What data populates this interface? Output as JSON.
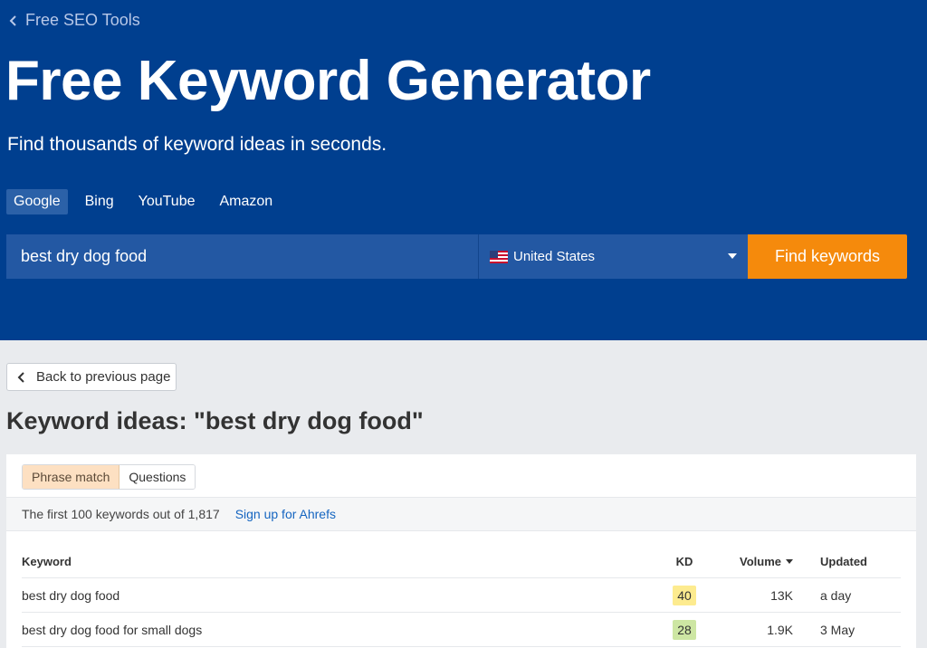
{
  "breadcrumb": {
    "label": "Free SEO Tools"
  },
  "hero": {
    "title": "Free Keyword Generator",
    "subtitle": "Find thousands of keyword ideas in seconds."
  },
  "engines": [
    {
      "label": "Google",
      "active": true
    },
    {
      "label": "Bing",
      "active": false
    },
    {
      "label": "YouTube",
      "active": false
    },
    {
      "label": "Amazon",
      "active": false
    }
  ],
  "search": {
    "query": "best dry dog food",
    "country": "United States",
    "submit_label": "Find keywords"
  },
  "back_label": "Back to previous page",
  "results": {
    "heading": "Keyword ideas: \"best dry dog food\"",
    "tabs": [
      {
        "label": "Phrase match",
        "active": true
      },
      {
        "label": "Questions",
        "active": false
      }
    ],
    "count_text": "The first 100 keywords out of 1,817",
    "signup_label": "Sign up for Ahrefs",
    "columns": {
      "keyword": "Keyword",
      "kd": "KD",
      "volume": "Volume",
      "updated": "Updated"
    },
    "rows": [
      {
        "keyword": "best dry dog food",
        "kd": "40",
        "kd_color": "#fdeb8f",
        "volume": "13K",
        "updated": "a day"
      },
      {
        "keyword": "best dry dog food for small dogs",
        "kd": "28",
        "kd_color": "#cde6a3",
        "volume": "1.9K",
        "updated": "3 May"
      }
    ]
  },
  "colors": {
    "hero_bg": "#003f8f",
    "cta": "#f58a0c",
    "link": "#1565c0"
  }
}
